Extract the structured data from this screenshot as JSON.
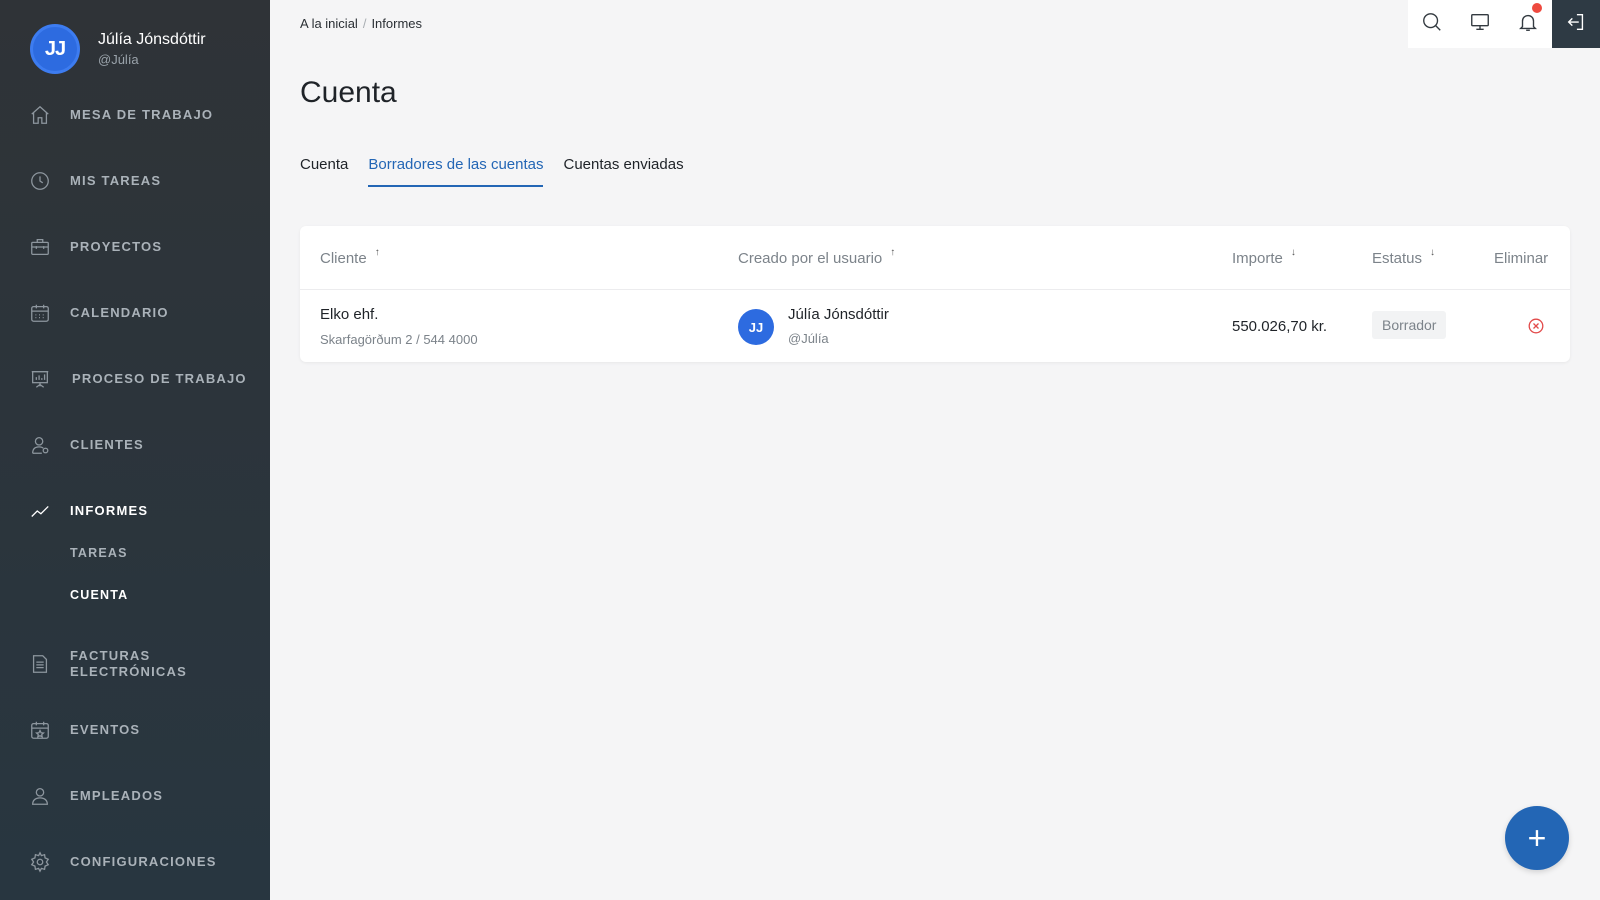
{
  "user": {
    "initials": "JJ",
    "name": "Júlía Jónsdóttir",
    "handle": "@Júlía"
  },
  "nav": {
    "items": [
      {
        "label": "MESA DE TRABAJO",
        "icon": "home-icon"
      },
      {
        "label": "MIS TAREAS",
        "icon": "clock-icon"
      },
      {
        "label": "PROYECTOS",
        "icon": "briefcase-icon"
      },
      {
        "label": "CALENDARIO",
        "icon": "calendar-icon"
      },
      {
        "label": "PROCESO DE TRABAJO",
        "icon": "presentation-chart-icon"
      },
      {
        "label": "CLIENTES",
        "icon": "user-icon"
      },
      {
        "label": "INFORMES",
        "icon": "trend-line-icon"
      },
      {
        "label": "FACTURAS\nELECTRÓNICAS",
        "icon": "document-icon"
      },
      {
        "label": "EVENTOS",
        "icon": "calendar-star-icon"
      },
      {
        "label": "EMPLEADOS",
        "icon": "users-icon"
      },
      {
        "label": "CONFIGURACIONES",
        "icon": "gear-icon"
      }
    ],
    "sub_items": [
      {
        "label": "TAREAS"
      },
      {
        "label": "CUENTA"
      }
    ]
  },
  "breadcrumb": {
    "home": "A la inicial",
    "sep": "/",
    "current": "Informes"
  },
  "page": {
    "title": "Cuenta"
  },
  "tabs": [
    {
      "label": "Cuenta"
    },
    {
      "label": "Borradores de las cuentas"
    },
    {
      "label": "Cuentas enviadas"
    }
  ],
  "table": {
    "headers": {
      "client": "Cliente",
      "client_sort": "↑",
      "created_by": "Creado por el usuario",
      "created_by_sort": "↑",
      "amount": "Importe",
      "amount_sort": "↓",
      "status": "Estatus",
      "status_sort": "↓",
      "delete": "Eliminar"
    },
    "rows": [
      {
        "client_name": "Elko ehf.",
        "client_address": "Skarfagörðum 2 / 544 4000",
        "user_initials": "JJ",
        "user_name": "Júlía Jónsdóttir",
        "user_handle": "@Júlía",
        "amount": "550.026,70 kr.",
        "status": "Borrador"
      }
    ]
  },
  "fab": {
    "label": "+"
  },
  "colors": {
    "accent": "#2366b5",
    "sidebar": "#2f3337",
    "danger": "#e24a4a",
    "notification": "#ee4a3f"
  }
}
